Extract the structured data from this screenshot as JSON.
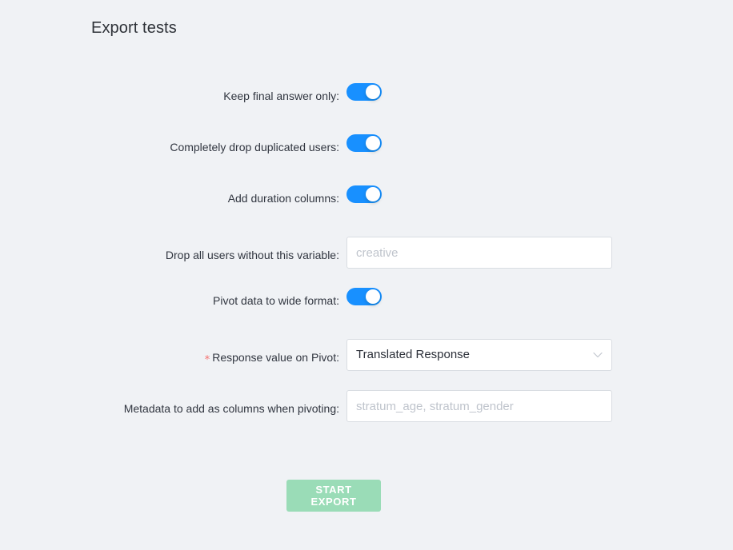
{
  "page": {
    "title": "Export tests",
    "background_color": "#f0f2f5"
  },
  "colors": {
    "toggle_on": "#1890ff",
    "required_star": "#f5706e",
    "submit_button_bg": "#9adcb7",
    "submit_button_text": "#ffffff",
    "input_border": "#d9dde2",
    "placeholder_text": "#bfc4cc",
    "label_text": "#313640"
  },
  "form": {
    "rows": [
      {
        "id": "keep-final-answer-only",
        "label": "Keep final answer only",
        "colon": ":",
        "required": false,
        "type": "toggle",
        "value": "on"
      },
      {
        "id": "completely-drop-duplicated-users",
        "label": "Completely drop duplicated users",
        "colon": ":",
        "required": false,
        "type": "toggle",
        "value": "on"
      },
      {
        "id": "add-duration-columns",
        "label": "Add duration columns",
        "colon": ":",
        "required": false,
        "type": "toggle",
        "value": "on"
      },
      {
        "id": "drop-all-users-without-this-variable",
        "label": "Drop all users without this variable",
        "colon": ":",
        "required": false,
        "type": "text",
        "value": "",
        "placeholder": "creative"
      },
      {
        "id": "pivot-data-to-wide-format",
        "label": "Pivot data to wide format",
        "colon": ":",
        "required": false,
        "type": "toggle",
        "value": "on"
      },
      {
        "id": "response-value-on-pivot",
        "label": "Response value on Pivot",
        "colon": ":",
        "required": true,
        "required_marker": "*",
        "type": "select",
        "value": "Translated Response",
        "arrow_icon": "chevron-down-icon"
      },
      {
        "id": "metadata-to-add-as-columns-when-pivoting",
        "label": "Metadata to add as columns when pivoting",
        "colon": ":",
        "required": false,
        "type": "text",
        "value": "",
        "placeholder": "stratum_age, stratum_gender"
      }
    ],
    "submit": {
      "label": "START EXPORT"
    }
  }
}
